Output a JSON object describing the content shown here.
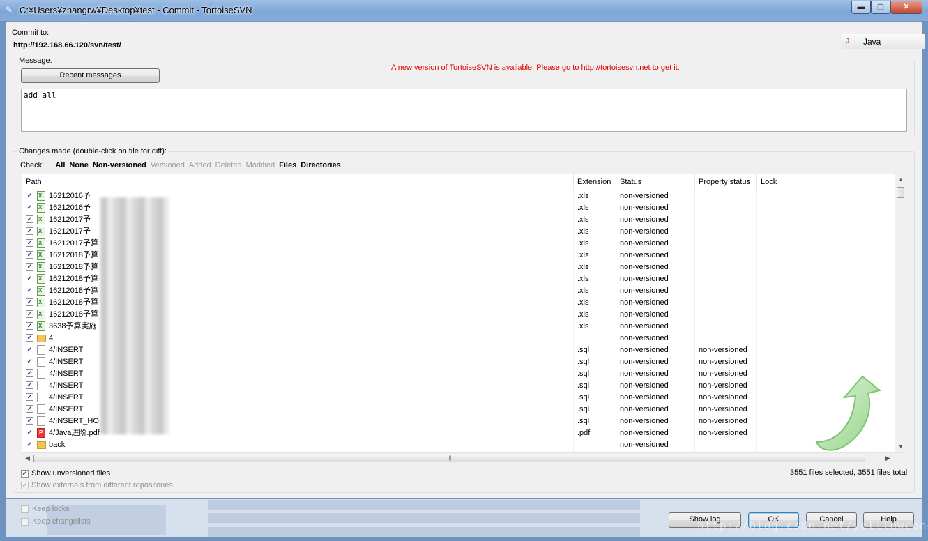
{
  "window": {
    "title": "C:¥Users¥zhangrw¥Desktop¥test - Commit - TortoiseSVN",
    "min_symbol": "▬",
    "max_symbol": "▢",
    "close_symbol": "✕"
  },
  "commit": {
    "label": "Commit to:",
    "url": "http://192.168.66.120/svn/test/"
  },
  "java_tab": {
    "label": "Java",
    "icon": "java-icon"
  },
  "message": {
    "group_label": "Message:",
    "recent_button": "Recent messages",
    "update_notice": "A new version of TortoiseSVN is available. Please go to http://tortoisesvn.net to get it.",
    "text": "add all"
  },
  "changes": {
    "group_label": "Changes made (double-click on file for diff):",
    "check_label": "Check:",
    "filters": [
      {
        "label": "All",
        "enabled": true
      },
      {
        "label": "None",
        "enabled": true
      },
      {
        "label": "Non-versioned",
        "enabled": true
      },
      {
        "label": "Versioned",
        "enabled": false
      },
      {
        "label": "Added",
        "enabled": false
      },
      {
        "label": "Deleted",
        "enabled": false
      },
      {
        "label": "Modified",
        "enabled": false
      },
      {
        "label": "Files",
        "enabled": true
      },
      {
        "label": "Directories",
        "enabled": true
      }
    ],
    "columns": [
      "Path",
      "Extension",
      "Status",
      "Property status",
      "Lock"
    ],
    "rows": [
      {
        "icon": "xls",
        "path": "16212016予",
        "ext": ".xls",
        "status": "non-versioned",
        "prop": ""
      },
      {
        "icon": "xls",
        "path": "16212016予",
        "ext": ".xls",
        "status": "non-versioned",
        "prop": ""
      },
      {
        "icon": "xls",
        "path": "16212017予",
        "ext": ".xls",
        "status": "non-versioned",
        "prop": ""
      },
      {
        "icon": "xls",
        "path": "16212017予",
        "ext": ".xls",
        "status": "non-versioned",
        "prop": ""
      },
      {
        "icon": "xls",
        "path": "16212017予算",
        "ext": ".xls",
        "status": "non-versioned",
        "prop": ""
      },
      {
        "icon": "xls",
        "path": "16212018予算",
        "ext": ".xls",
        "status": "non-versioned",
        "prop": ""
      },
      {
        "icon": "xls",
        "path": "16212018予算",
        "ext": ".xls",
        "status": "non-versioned",
        "prop": ""
      },
      {
        "icon": "xls",
        "path": "16212018予算",
        "ext": ".xls",
        "status": "non-versioned",
        "prop": ""
      },
      {
        "icon": "xls",
        "path": "16212018予算",
        "ext": ".xls",
        "status": "non-versioned",
        "prop": ""
      },
      {
        "icon": "xls",
        "path": "16212018予算",
        "ext": ".xls",
        "status": "non-versioned",
        "prop": ""
      },
      {
        "icon": "xls",
        "path": "16212018予算",
        "ext": ".xls",
        "status": "non-versioned",
        "prop": ""
      },
      {
        "icon": "xls",
        "path": "3638予算実施",
        "ext": ".xls",
        "status": "non-versioned",
        "prop": ""
      },
      {
        "icon": "folder",
        "path": "4",
        "ext": "",
        "status": "non-versioned",
        "prop": ""
      },
      {
        "icon": "sql",
        "path": "4/INSERT",
        "ext": ".sql",
        "status": "non-versioned",
        "prop": "non-versioned"
      },
      {
        "icon": "sql",
        "path": "4/INSERT",
        "ext": ".sql",
        "status": "non-versioned",
        "prop": "non-versioned"
      },
      {
        "icon": "sql",
        "path": "4/INSERT",
        "ext": ".sql",
        "status": "non-versioned",
        "prop": "non-versioned"
      },
      {
        "icon": "sql",
        "path": "4/INSERT",
        "ext": ".sql",
        "status": "non-versioned",
        "prop": "non-versioned"
      },
      {
        "icon": "sql",
        "path": "4/INSERT",
        "ext": ".sql",
        "status": "non-versioned",
        "prop": "non-versioned"
      },
      {
        "icon": "sql",
        "path": "4/INSERT",
        "ext": ".sql",
        "status": "non-versioned",
        "prop": "non-versioned"
      },
      {
        "icon": "sql",
        "path": "4/INSERT_HO",
        "ext": ".sql",
        "status": "non-versioned",
        "prop": "non-versioned"
      },
      {
        "icon": "pdf",
        "path": "4/Java进阶.pdf",
        "ext": ".pdf",
        "status": "non-versioned",
        "prop": "non-versioned"
      },
      {
        "icon": "folder",
        "path": "back",
        "ext": "",
        "status": "non-versioned",
        "prop": ""
      }
    ]
  },
  "options": {
    "show_unversioned": "Show unversioned files",
    "show_externals": "Show externals from different repositories",
    "selection_summary": "3551 files selected, 3551 files total",
    "keep_locks": "Keep locks",
    "keep_changelists": "Keep changelists"
  },
  "buttons": {
    "show_log": "Show log",
    "ok": "OK",
    "cancel": "Cancel",
    "help": "Help"
  },
  "watermark": "http://blog.csdn.net/yelllowcong"
}
